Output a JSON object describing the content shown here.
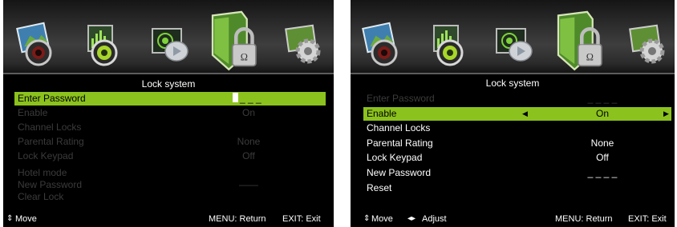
{
  "left": {
    "title": "Lock system",
    "rows": [
      {
        "label": "Enter Password",
        "value": "_ _ _"
      },
      {
        "label": "Enable",
        "value": "On"
      },
      {
        "label": "Channel Locks",
        "value": ""
      },
      {
        "label": "Parental Rating",
        "value": "None"
      },
      {
        "label": "Lock Keypad",
        "value": "Off"
      },
      {
        "label": "Hotel mode",
        "value": ""
      },
      {
        "label": "New Password",
        "value": "——"
      },
      {
        "label": "Clear Lock",
        "value": ""
      }
    ],
    "footer": {
      "move_symbol": "⇕",
      "move": "Move",
      "menu": "MENU: Return",
      "exit": "EXIT: Exit"
    }
  },
  "right": {
    "title": "Lock system",
    "rows": [
      {
        "label": "Enter Password",
        "value": "_ _ _ _"
      },
      {
        "label": "Enable",
        "value": "On"
      },
      {
        "label": "Channel Locks",
        "value": ""
      },
      {
        "label": "Parental Rating",
        "value": "None"
      },
      {
        "label": "Lock Keypad",
        "value": "Off"
      },
      {
        "label": "New Password",
        "value": "_ _ _ _"
      },
      {
        "label": "Reset",
        "value": ""
      }
    ],
    "footer": {
      "move_symbol": "⇕",
      "move": "Move",
      "adjust_symbol": "◂▸",
      "adjust": "Adjust",
      "menu": "MENU: Return",
      "exit": "EXIT: Exit"
    }
  },
  "icons": [
    "picture-icon",
    "sound-icon",
    "channel-icon",
    "lock-icon",
    "setup-icon"
  ],
  "colors": {
    "highlight": "#8bc21d",
    "background": "#000000",
    "text": "#ffffff",
    "disabled_text": "#3b3b3b"
  }
}
